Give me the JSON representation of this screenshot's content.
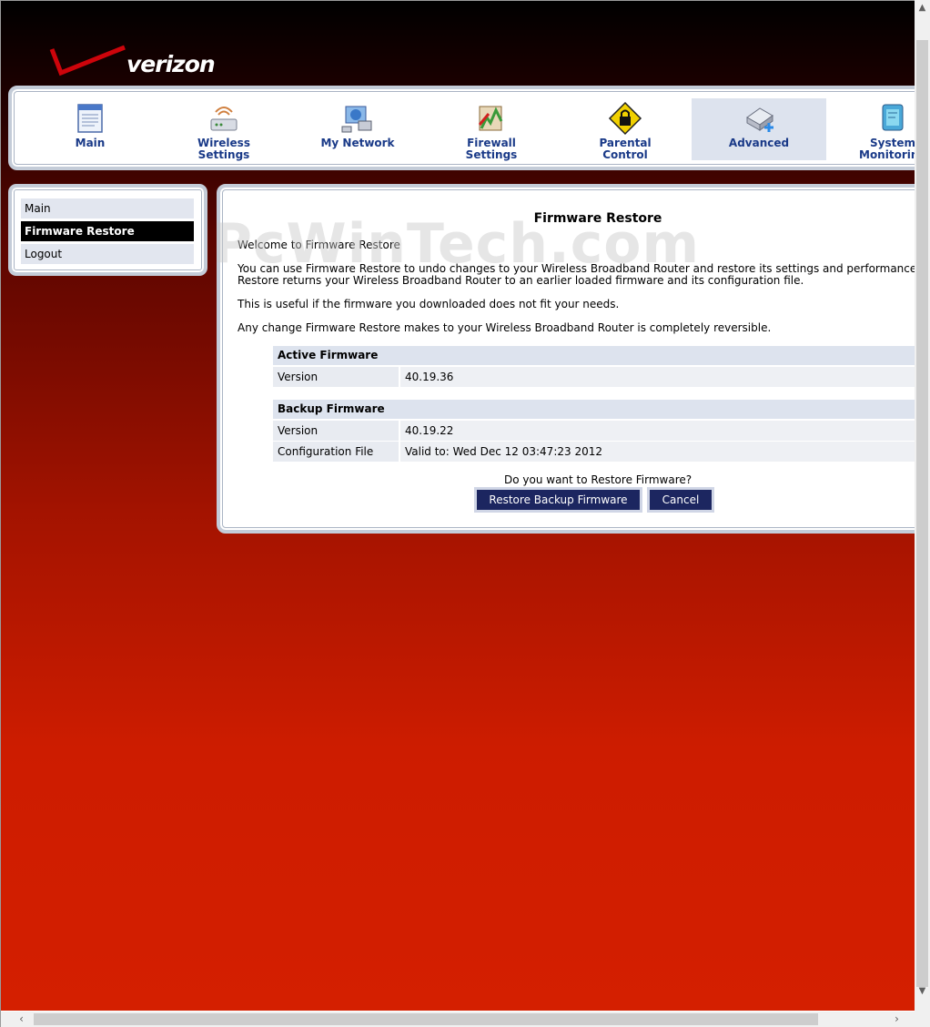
{
  "brand": {
    "logo_text": "verizon",
    "brand_color": "#cd040b"
  },
  "nav": {
    "items": [
      {
        "label_line1": "Main",
        "label_line2": "",
        "icon": "main-page-icon"
      },
      {
        "label_line1": "Wireless",
        "label_line2": "Settings",
        "icon": "wireless-router-icon"
      },
      {
        "label_line1": "My Network",
        "label_line2": "",
        "icon": "network-computer-icon"
      },
      {
        "label_line1": "Firewall",
        "label_line2": "Settings",
        "icon": "firewall-icon"
      },
      {
        "label_line1": "Parental",
        "label_line2": "Control",
        "icon": "lock-icon"
      },
      {
        "label_line1": "Advanced",
        "label_line2": "",
        "icon": "advanced-device-icon",
        "active": true
      },
      {
        "label_line1": "System",
        "label_line2": "Monitoring",
        "icon": "monitor-icon"
      }
    ]
  },
  "sidebar": {
    "items": [
      {
        "label": "Main"
      },
      {
        "label": "Firmware Restore",
        "active": true
      },
      {
        "label": "Logout"
      }
    ]
  },
  "main": {
    "title": "Firmware Restore",
    "welcome": "Welcome to Firmware Restore",
    "intro_line1": "You can use Firmware Restore to undo changes to your Wireless Broadband Router and restore its settings and performance. Firmware",
    "intro_line2": "Restore returns your Wireless Broadband Router to an earlier loaded firmware and its configuration file.",
    "useful": "This is useful if the firmware you downloaded does not fit your needs.",
    "reversible": "Any change Firmware Restore makes to your Wireless Broadband Router is completely reversible.",
    "active_firmware": {
      "heading": "Active Firmware",
      "rows": [
        {
          "label": "Version",
          "value": "40.19.36"
        }
      ]
    },
    "backup_firmware": {
      "heading": "Backup Firmware",
      "rows": [
        {
          "label": "Version",
          "value": "40.19.22"
        },
        {
          "label": "Configuration File",
          "value": "Valid to: Wed Dec 12 03:47:23 2012"
        }
      ]
    },
    "question": "Do you want to Restore Firmware?",
    "restore_button": "Restore Backup Firmware",
    "cancel_button": "Cancel"
  },
  "watermark": "PcWinTech.com"
}
